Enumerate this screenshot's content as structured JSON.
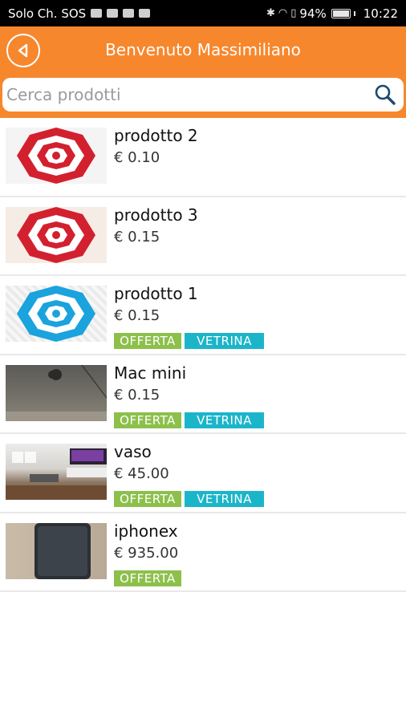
{
  "status_bar": {
    "carrier": "Solo Ch. SOS",
    "battery": "94%",
    "time": "10:22"
  },
  "header": {
    "title": "Benvenuto Massimiliano"
  },
  "search": {
    "placeholder": "Cerca prodotti"
  },
  "colors": {
    "header": "#f7872d",
    "offerta": "#8cc04b",
    "vetrina": "#1bb5ca"
  },
  "badges": {
    "offerta": "OFFERTA",
    "vetrina": "VETRINA"
  },
  "products": [
    {
      "name": "prodotto 2",
      "price": "€ 0.10",
      "image": "red-umbrella"
    },
    {
      "name": "prodotto 3",
      "price": "€ 0.15",
      "image": "red-umbrella"
    },
    {
      "name": "prodotto 1",
      "price": "€ 0.15",
      "image": "blue-umbrella"
    },
    {
      "name": "Mac mini",
      "price": "€ 0.15",
      "image": "mac-photo"
    },
    {
      "name": "vaso",
      "price": "€ 45.00",
      "image": "room-photo"
    },
    {
      "name": "iphonex",
      "price": "€ 935.00",
      "image": "phone-photo"
    }
  ]
}
